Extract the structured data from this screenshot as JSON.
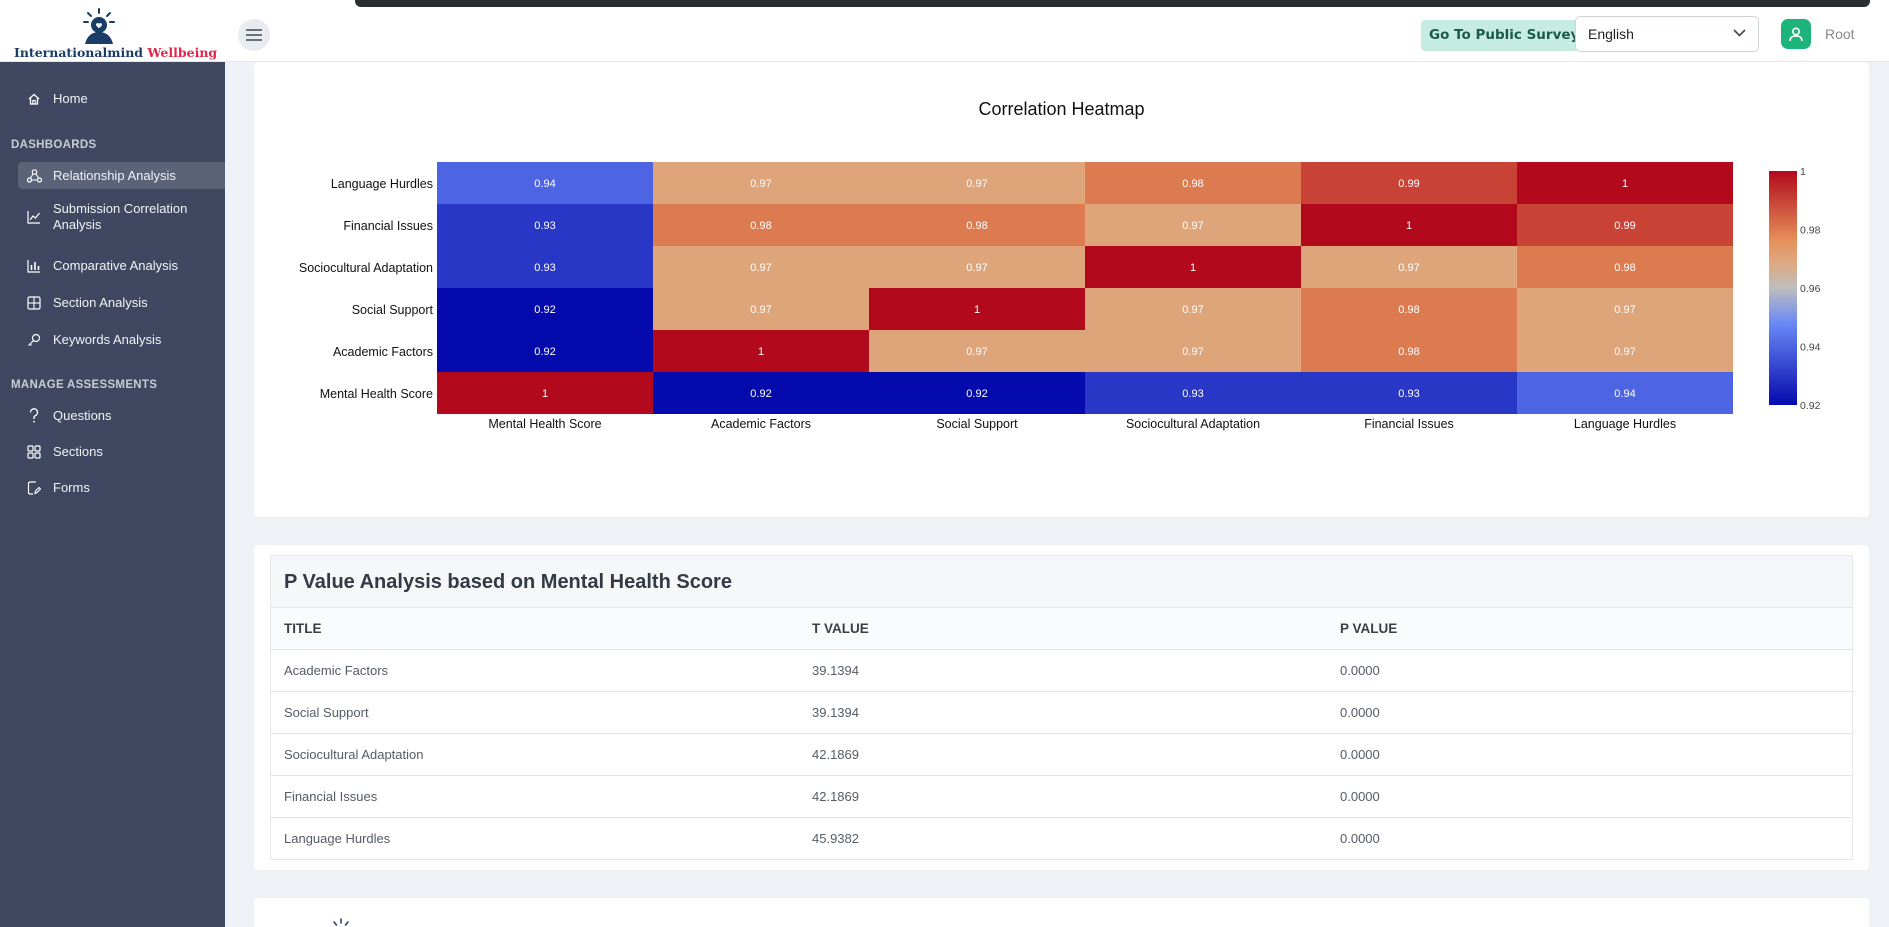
{
  "brand": {
    "name_part1": "Internationalmind",
    "name_part2": "Wellbeing",
    "accent": "#e4254a",
    "primary": "#1a3d68"
  },
  "header": {
    "menu_icon": "hamburger-icon",
    "public_surveys_label": "Go To Public Surveys",
    "language": "English",
    "user_name": "Root",
    "user_icon": "user-icon"
  },
  "sidebar": {
    "home": {
      "label": "Home",
      "icon": "home-icon"
    },
    "sections": [
      {
        "title": "DASHBOARDS",
        "items": [
          {
            "label": "Relationship Analysis",
            "icon": "share-nodes-icon",
            "active": true
          },
          {
            "label": "Submission Correlation Analysis",
            "icon": "line-chart-icon"
          },
          {
            "label": "Comparative Analysis",
            "icon": "bar-chart-icon"
          },
          {
            "label": "Section Analysis",
            "icon": "table-icon"
          },
          {
            "label": "Keywords Analysis",
            "icon": "key-icon"
          }
        ]
      },
      {
        "title": "MANAGE ASSESSMENTS",
        "items": [
          {
            "label": "Questions",
            "icon": "question-icon"
          },
          {
            "label": "Sections",
            "icon": "grid-icon"
          },
          {
            "label": "Forms",
            "icon": "edit-file-icon"
          }
        ]
      }
    ]
  },
  "chart_data": {
    "type": "heatmap",
    "title": "Correlation Heatmap",
    "x_categories": [
      "Mental Health Score",
      "Academic Factors",
      "Social Support",
      "Sociocultural Adaptation",
      "Financial Issues",
      "Language Hurdles"
    ],
    "y_categories": [
      "Mental Health Score",
      "Academic Factors",
      "Social Support",
      "Sociocultural Adaptation",
      "Financial Issues",
      "Language Hurdles"
    ],
    "values": [
      [
        1,
        0.92,
        0.92,
        0.93,
        0.93,
        0.94
      ],
      [
        0.92,
        1,
        0.97,
        0.97,
        0.98,
        0.97
      ],
      [
        0.92,
        0.97,
        1,
        0.97,
        0.98,
        0.97
      ],
      [
        0.93,
        0.97,
        0.97,
        1,
        0.97,
        0.98
      ],
      [
        0.93,
        0.98,
        0.98,
        0.97,
        1,
        0.99
      ],
      [
        0.94,
        0.97,
        0.97,
        0.98,
        0.99,
        1
      ]
    ],
    "colorscale": "RdBu reversed",
    "zrange": [
      0.92,
      1
    ],
    "colorbar_ticks": [
      "1",
      "0.98",
      "0.96",
      "0.94",
      "0.92"
    ],
    "y_order": "bottom-to-top"
  },
  "pvalue": {
    "title": "P Value Analysis based on Mental Health Score",
    "columns": [
      "TITLE",
      "T VALUE",
      "P VALUE"
    ],
    "rows": [
      [
        "Academic Factors",
        "39.1394",
        "0.0000"
      ],
      [
        "Social Support",
        "39.1394",
        "0.0000"
      ],
      [
        "Sociocultural Adaptation",
        "42.1869",
        "0.0000"
      ],
      [
        "Financial Issues",
        "42.1869",
        "0.0000"
      ],
      [
        "Language Hurdles",
        "45.9382",
        "0.0000"
      ]
    ]
  }
}
